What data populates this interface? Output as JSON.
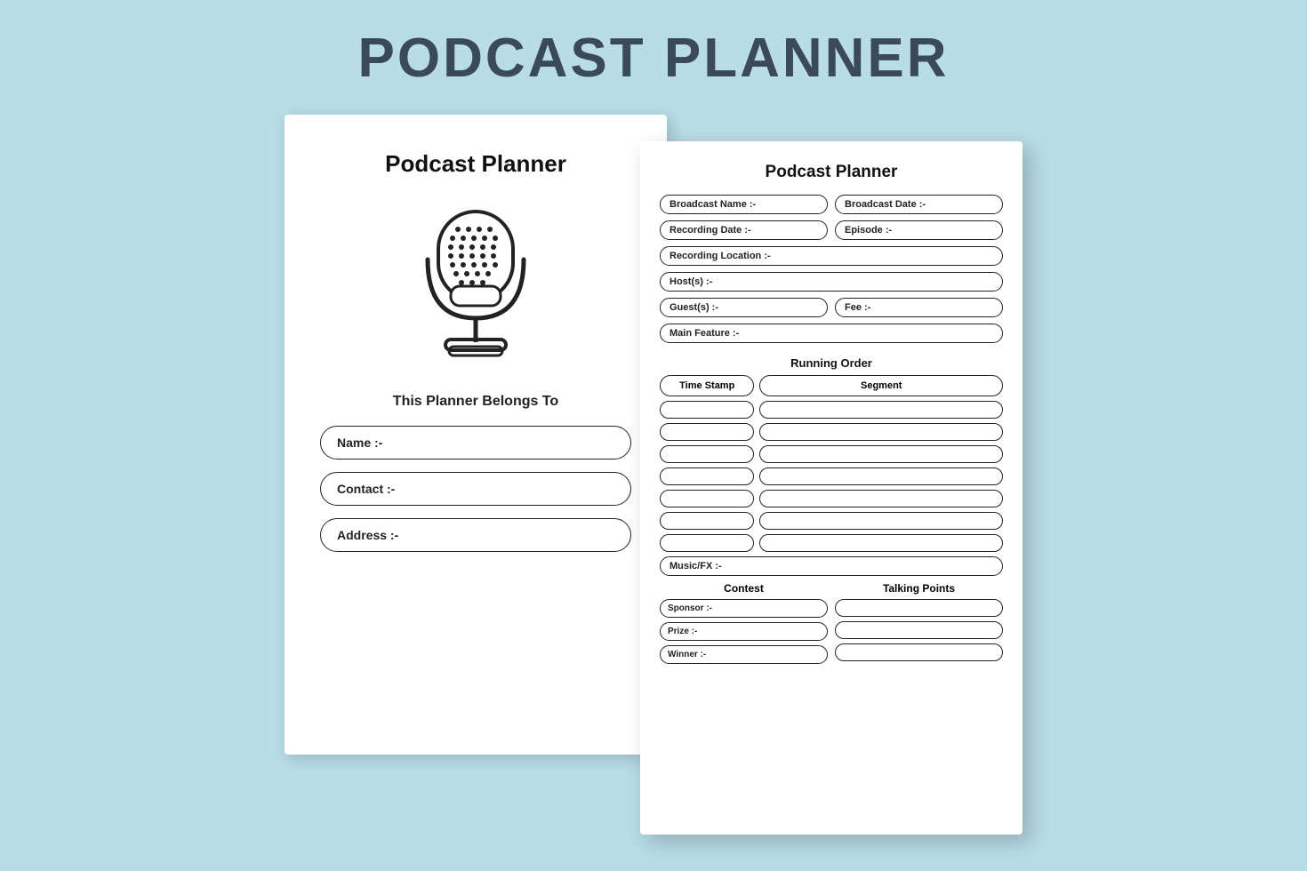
{
  "header": {
    "title": "PODCAST PLANNER"
  },
  "cover": {
    "title": "Podcast Planner",
    "belongs_to": "This Planner Belongs To",
    "name_label": "Name :-",
    "contact_label": "Contact :-",
    "address_label": "Address :-"
  },
  "inner": {
    "title": "Podcast Planner",
    "fields": {
      "broadcast_name": "Broadcast Name :-",
      "broadcast_date": "Broadcast Date :-",
      "recording_date": "Recording Date :-",
      "episode": "Episode :-",
      "recording_location": "Recording Location :-",
      "host": "Host(s) :-",
      "guest": "Guest(s) :-",
      "fee": "Fee :-",
      "main_feature": "Main Feature :-"
    },
    "running_order": {
      "header": "Running Order",
      "col_timestamp": "Time Stamp",
      "col_segment": "Segment",
      "rows": 7
    },
    "music_fx": "Music/FX :-",
    "contest": {
      "header": "Contest",
      "sponsor": "Sponsor :-",
      "prize": "Prize :-",
      "winner": "Winner :-"
    },
    "talking_points": {
      "header": "Talking Points"
    }
  }
}
